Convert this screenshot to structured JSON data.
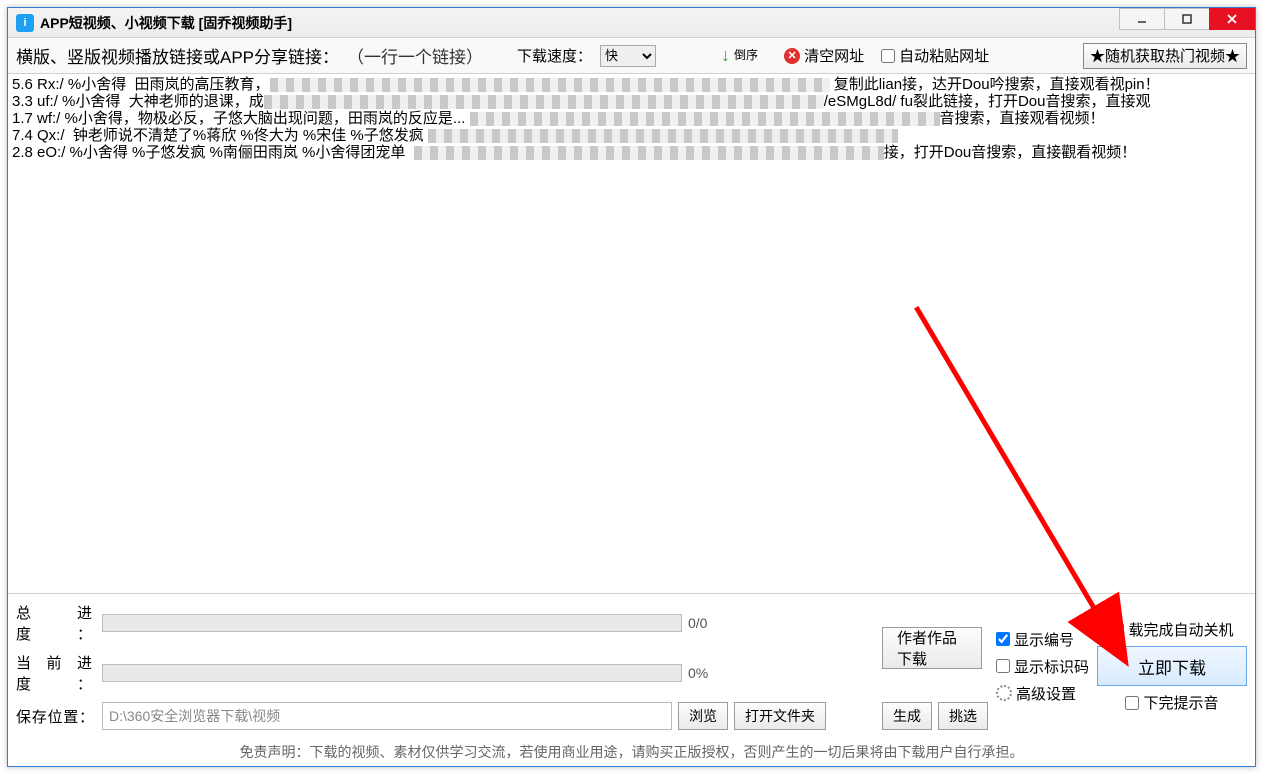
{
  "window_title": "APP短视频、小视频下载 [固乔视频助手]",
  "toolbar": {
    "main_label": "横版、竖版视频播放链接或APP分享链接：",
    "hint": "（一行一个链接）",
    "speed_label": "下载速度：",
    "speed_value": "快",
    "reverse_label": "倒序",
    "clear_label": "清空网址",
    "auto_paste_label": "自动粘贴网址",
    "random_btn": "★随机获取热门视频★"
  },
  "textarea_lines": [
    {
      "pre": "5.6 Rx:/ %小舍得  田雨岚的高压教育，",
      "post": " 复制此lian接，达开Dou吟搜索，直接观看视pin！",
      "mask": 560
    },
    {
      "pre": "3.3 uf:/ %小舍得  大神老师的退课，成",
      "post": "/eSMgL8d/ fu裂此链接，打开Dou音搜索，直接观",
      "mask": 560
    },
    {
      "pre": "1.7 wf:/ %小舍得，物极必反，子悠大脑出现问题，田雨岚的反应是... ",
      "post": "音搜索，直接观看视频！",
      "mask": 470
    },
    {
      "pre": "7.4 Qx:/  钟老师说不清楚了%蒋欣 %佟大为 %宋佳 %子悠发疯 ",
      "post": "",
      "mask": 470
    },
    {
      "pre": "2.8 eO:/ %小舍得 %子悠发疯 %南俪田雨岚 %小舍得团宠单  ",
      "post": "接，打开Dou音搜索，直接觀看视频！",
      "mask": 470
    }
  ],
  "bottom": {
    "total_label": "总 进 度：",
    "total_pct": "0/0",
    "current_label": "当前进度：",
    "current_pct": "0%",
    "path_label": "保存位置：",
    "path_value": "D:\\360安全浏览器下载\\视频",
    "browse": "浏览",
    "open_folder": "打开文件夹",
    "author_dl": "作者作品下载",
    "gen": "生成",
    "pick": "挑选",
    "adv": "高级设置",
    "show_index": "显示编号",
    "show_id": "显示标识码",
    "auto_shutdown": "载完成自动关机",
    "download_now": "立即下载",
    "done_sound": "下完提示音",
    "disclaimer": "免责声明：下载的视频、素材仅供学习交流，若使用商业用途，请购买正版授权，否则产生的一切后果将由下载用户自行承担。"
  }
}
